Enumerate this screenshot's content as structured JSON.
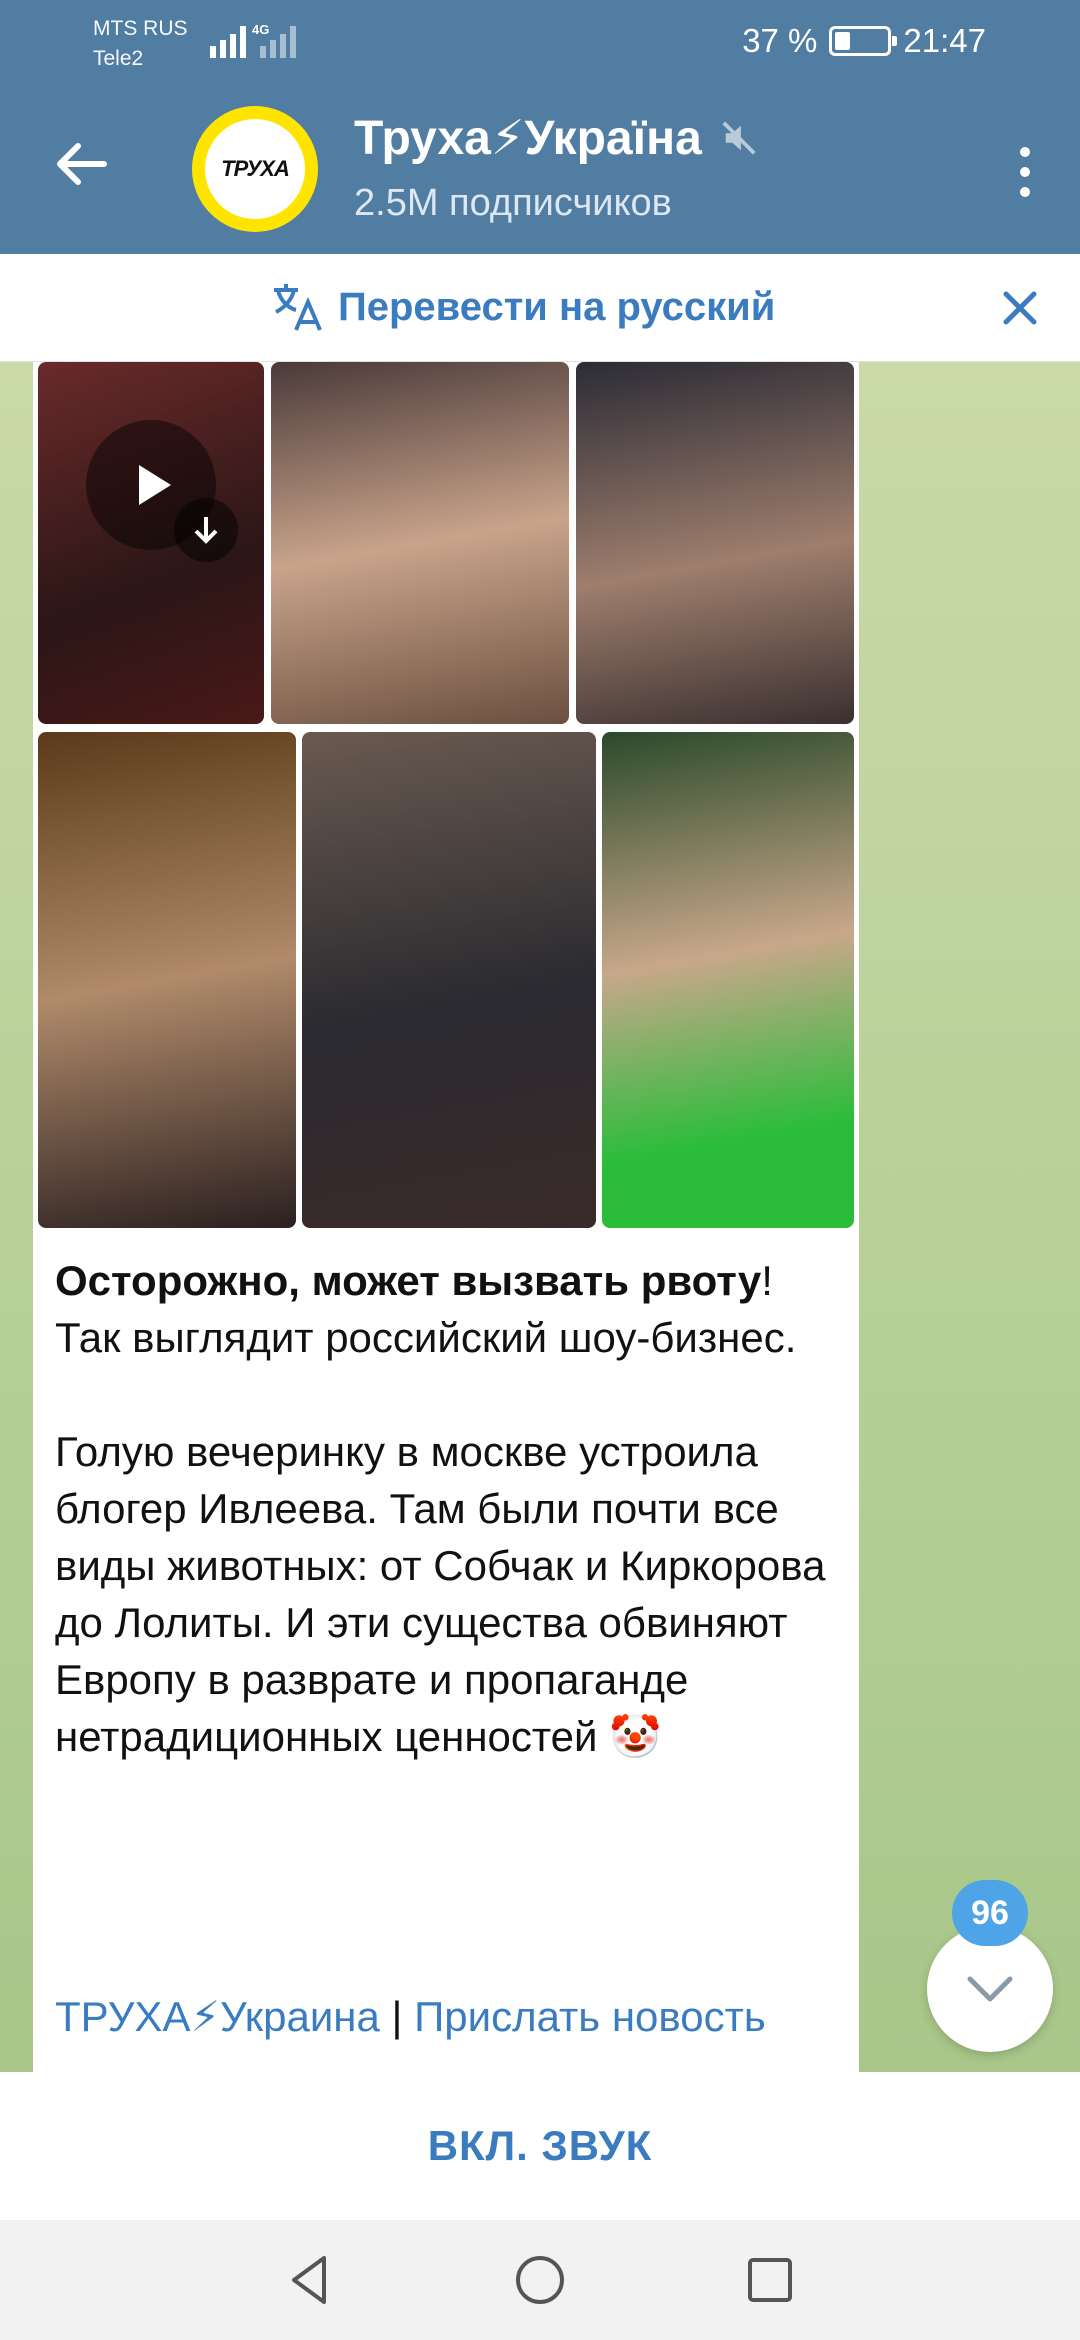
{
  "status_bar": {
    "carrier1": "MTS RUS",
    "carrier2": "Tele2",
    "network": "4G",
    "battery_text": "37 %",
    "battery_level": 0.37,
    "time": "21:47"
  },
  "header": {
    "avatar_text": "ТРУХА",
    "channel_name": "Труха⚡Україна",
    "subscribers": "2.5M подписчиков"
  },
  "translate_bar": {
    "label": "Перевести на русский"
  },
  "message": {
    "bold_part": "Осторожно, может вызвать рвоту",
    "after_bold": "! Так выглядит российский шоу-бизнес.",
    "paragraph2": "Голую вечеринку в москве устроила блогер Ивлеева. Там были почти все виды животных: от Собчак и Киркорова до Лолиты. И эти существа обвиняют Европу в разврате и пропаганде нетрадиционных ценностей 🤡",
    "link1": "ТРУХА⚡Украина",
    "separator": " | ",
    "link2": "Прислать новость"
  },
  "scroll": {
    "unread_badge": "96"
  },
  "bottom_bar": {
    "sound_label": "ВКЛ. ЗВУК"
  },
  "colors": {
    "header_bg": "#517da2",
    "link": "#3a7cbf",
    "badge": "#4ea4e6"
  }
}
